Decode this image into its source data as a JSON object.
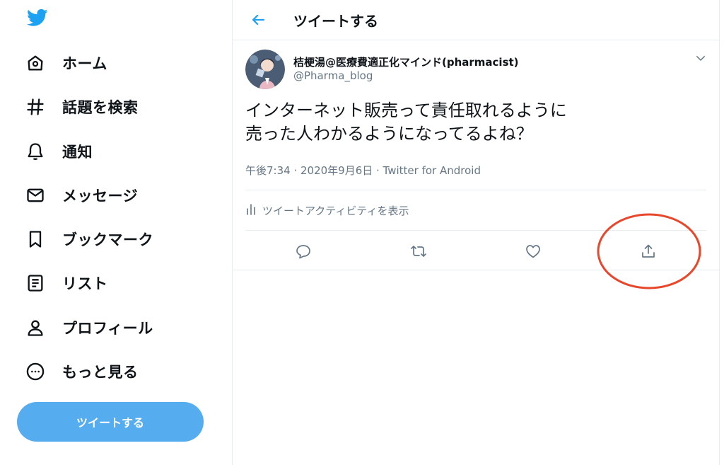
{
  "sidebar": {
    "logo_icon": "twitter-bird-icon",
    "items": [
      {
        "label": "ホーム",
        "icon": "home-icon"
      },
      {
        "label": "話題を検索",
        "icon": "hashtag-icon"
      },
      {
        "label": "通知",
        "icon": "bell-icon"
      },
      {
        "label": "メッセージ",
        "icon": "envelope-icon"
      },
      {
        "label": "ブックマーク",
        "icon": "bookmark-icon"
      },
      {
        "label": "リスト",
        "icon": "list-icon"
      },
      {
        "label": "プロフィール",
        "icon": "person-icon"
      },
      {
        "label": "もっと見る",
        "icon": "more-circle-icon"
      }
    ],
    "tweet_button": "ツイートする"
  },
  "header": {
    "back_icon": "back-arrow-icon",
    "title": "ツイートする"
  },
  "tweet": {
    "author_name": "桔梗湯@医療費適正化マインド(pharmacist)",
    "author_handle": "@Pharma_blog",
    "text_line1": "インターネット販売って責任取れるように",
    "text_line2": "売った人わかるようになってるよね？",
    "meta": "午後7:34 · 2020年9月6日 · Twitter for Android",
    "activity_label": "ツイートアクティビティを表示"
  },
  "actions": [
    "reply-icon",
    "retweet-icon",
    "like-icon",
    "share-icon"
  ],
  "colors": {
    "brand": "#1da1f2",
    "tweet_button": "#55acee",
    "muted": "#657786",
    "annotation": "#e8472b"
  }
}
